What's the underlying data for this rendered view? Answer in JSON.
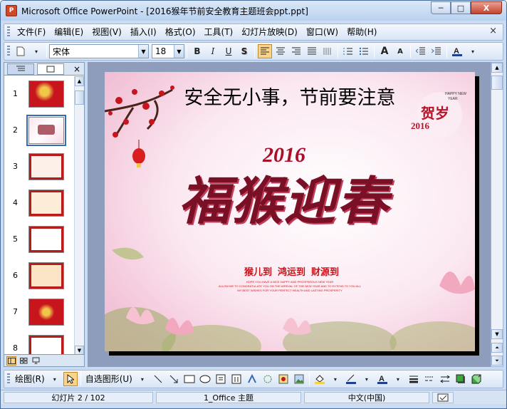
{
  "window": {
    "app_icon_letter": "P",
    "title": "Microsoft Office PowerPoint - [2016猴年节前安全教育主题班会ppt.ppt]",
    "minimize": "─",
    "maximize": "□",
    "close": "X"
  },
  "menu": {
    "items": [
      "文件(F)",
      "编辑(E)",
      "视图(V)",
      "插入(I)",
      "格式(O)",
      "工具(T)",
      "幻灯片放映(D)",
      "窗口(W)",
      "帮助(H)"
    ],
    "close_doc": "×"
  },
  "toolbar": {
    "font_name": "宋体",
    "font_size": "18",
    "bold": "B",
    "italic": "I",
    "underline": "U",
    "shadow": "S",
    "grow_font": "A",
    "shrink_font": "A"
  },
  "outline_pane": {
    "close": "×",
    "slides": [
      {
        "num": "1"
      },
      {
        "num": "2"
      },
      {
        "num": "3"
      },
      {
        "num": "4"
      },
      {
        "num": "5"
      },
      {
        "num": "6"
      },
      {
        "num": "7"
      },
      {
        "num": "8"
      }
    ]
  },
  "slide": {
    "title": "安全无小事，节前要注意",
    "year": "2016",
    "big_text": "福猴迎春",
    "slogan": [
      "猴儿到",
      "鸿运到",
      "财源到"
    ],
    "fine_print_1": "HOPE YOU HAVE A NICE HAPPY AND PROSPEROUS NEW YEAR",
    "fine_print_2": "ALLOW ME TO CONGRATULATE YOU ON THE ARRIVAL OF THE NEW YEAR AND TO EXTEND TO YOU ALL",
    "fine_print_3": "MY BEST WISHES FOR YOUR PERFECT HEALTH AND LASTING PROSPERITY",
    "badge_line1": "HAPPY NEW",
    "badge_line2": "YEAR",
    "badge_chars": "贺岁",
    "badge_year": "2016"
  },
  "drawbar": {
    "draw": "绘图(R)",
    "autoshapes": "自选图形(U)"
  },
  "status": {
    "slide_info": "幻灯片 2 / 102",
    "theme": "1_Office 主题",
    "language": "中文(中国)"
  },
  "colors": {
    "title_text": "#000000",
    "big_text": "#7a1025",
    "accent_red": "#c8151d"
  }
}
